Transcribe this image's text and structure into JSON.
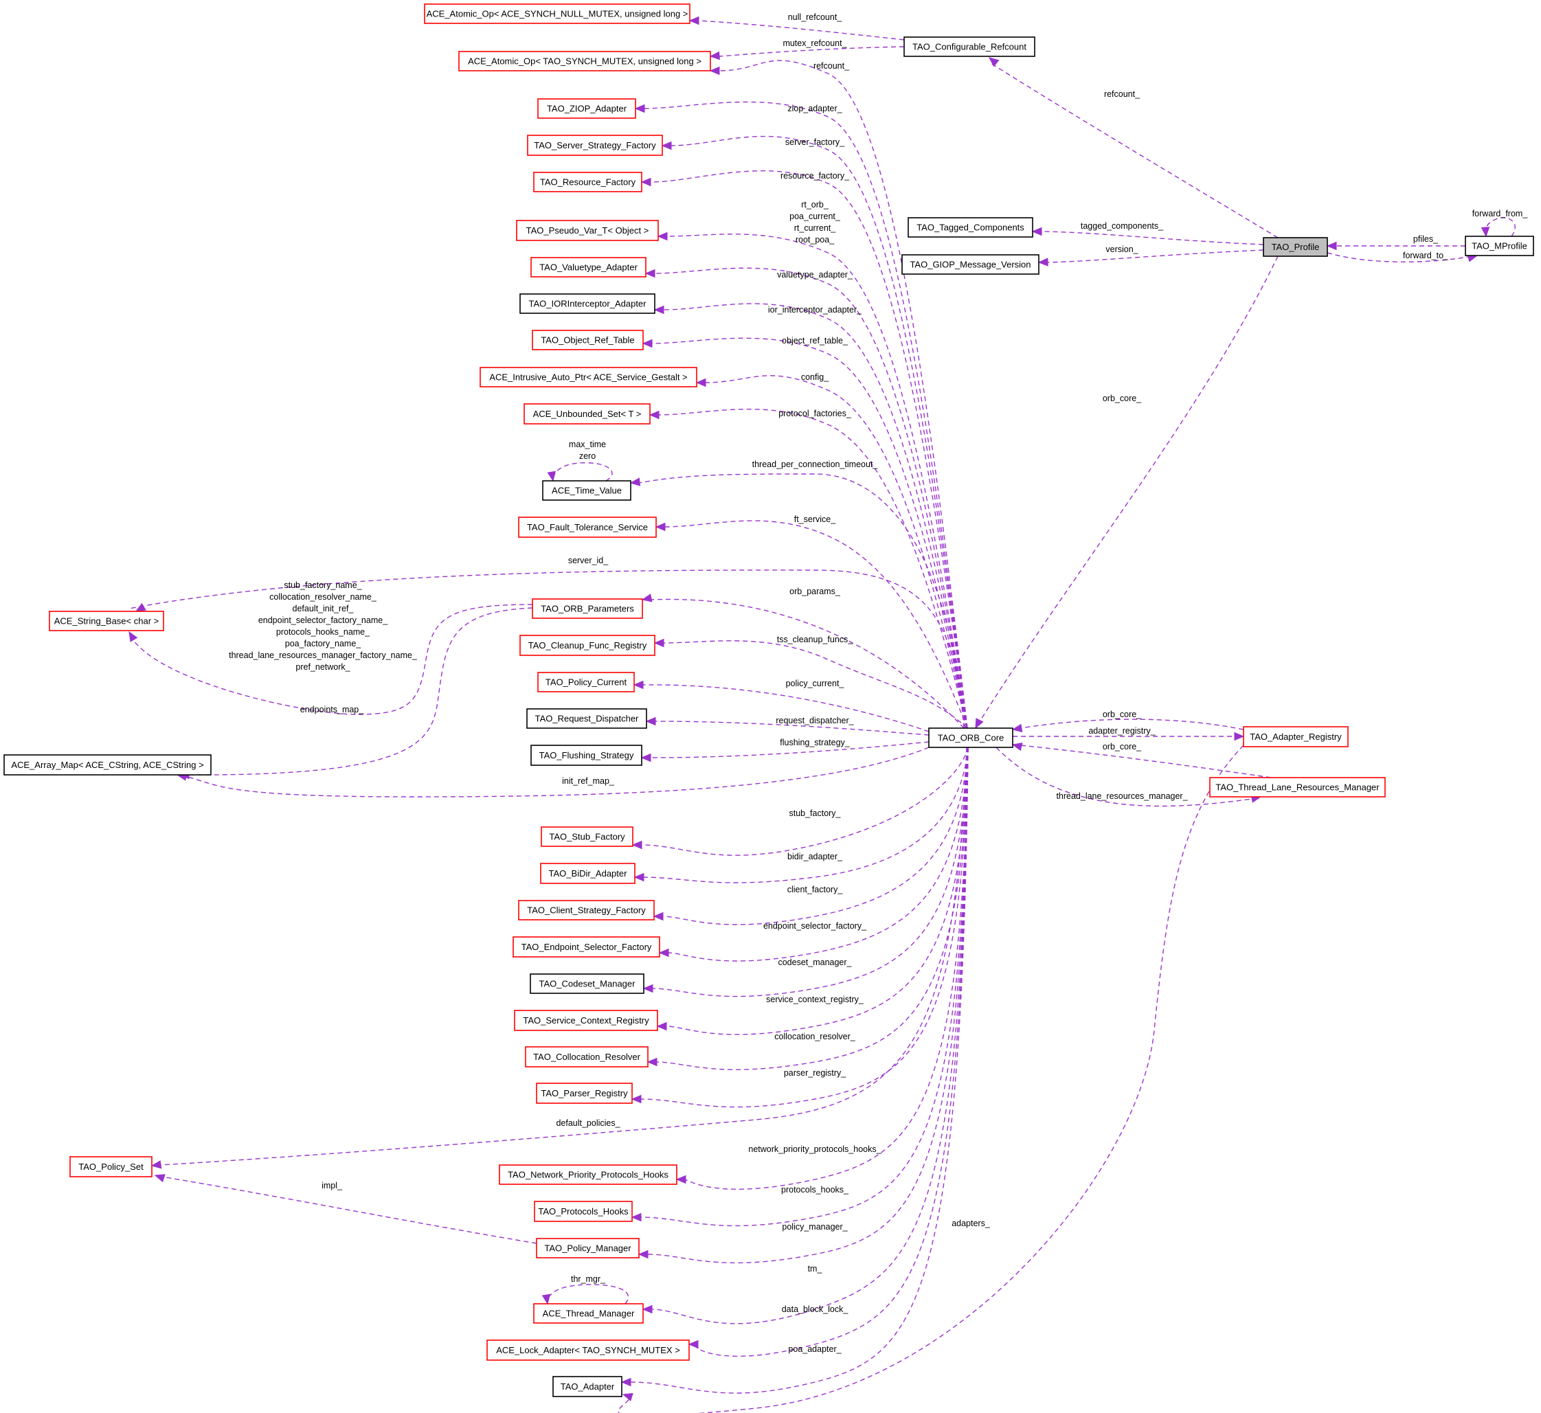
{
  "diagram": {
    "title": "TAO_Profile collaboration graph",
    "legend_colors": {
      "edge": "#9a32cd",
      "node_incomplete_border": "#ff0000",
      "node_complete_border": "#000000",
      "focus_fill": "#bfbfbf"
    },
    "nodes": {
      "atomic_null": "ACE_Atomic_Op< ACE_SYNCH_NULL_MUTEX, unsigned long >",
      "atomic_mutex": "ACE_Atomic_Op< TAO_SYNCH_MUTEX, unsigned long >",
      "configurable_refcount": "TAO_Configurable_Refcount",
      "ziop_adapter": "TAO_ZIOP_Adapter",
      "server_strategy_factory": "TAO_Server_Strategy_Factory",
      "resource_factory": "TAO_Resource_Factory",
      "pseudo_var": "TAO_Pseudo_Var_T< Object >",
      "tagged_components": "TAO_Tagged_Components",
      "giop_message_version": "TAO_GIOP_Message_Version",
      "profile": "TAO_Profile",
      "mprofile": "TAO_MProfile",
      "valuetype_adapter": "TAO_Valuetype_Adapter",
      "iorinterceptor_adapter": "TAO_IORInterceptor_Adapter",
      "object_ref_table": "TAO_Object_Ref_Table",
      "intrusive_auto_ptr": "ACE_Intrusive_Auto_Ptr< ACE_Service_Gestalt >",
      "unbounded_set": "ACE_Unbounded_Set< T >",
      "time_value": "ACE_Time_Value",
      "fault_tolerance_service": "TAO_Fault_Tolerance_Service",
      "string_base": "ACE_String_Base< char >",
      "orb_parameters": "TAO_ORB_Parameters",
      "cleanup_func_registry": "TAO_Cleanup_Func_Registry",
      "policy_current": "TAO_Policy_Current",
      "request_dispatcher": "TAO_Request_Dispatcher",
      "flushing_strategy": "TAO_Flushing_Strategy",
      "array_map": "ACE_Array_Map< ACE_CString, ACE_CString >",
      "orb_core": "TAO_ORB_Core",
      "adapter_registry": "TAO_Adapter_Registry",
      "thread_lane_resources_manager": "TAO_Thread_Lane_Resources_Manager",
      "stub_factory": "TAO_Stub_Factory",
      "bidir_adapter": "TAO_BiDir_Adapter",
      "client_strategy_factory": "TAO_Client_Strategy_Factory",
      "endpoint_selector_factory": "TAO_Endpoint_Selector_Factory",
      "codeset_manager": "TAO_Codeset_Manager",
      "service_context_registry": "TAO_Service_Context_Registry",
      "collocation_resolver": "TAO_Collocation_Resolver",
      "parser_registry": "TAO_Parser_Registry",
      "policy_set": "TAO_Policy_Set",
      "network_priority_protocols_hooks": "TAO_Network_Priority_Protocols_Hooks",
      "protocols_hooks": "TAO_Protocols_Hooks",
      "policy_manager": "TAO_Policy_Manager",
      "thread_manager": "ACE_Thread_Manager",
      "lock_adapter": "ACE_Lock_Adapter< TAO_SYNCH_MUTEX >",
      "adapter": "TAO_Adapter"
    },
    "edge_labels": {
      "null_refcount": "null_refcount_",
      "mutex_refcount": "mutex_refcount_",
      "refcount_orb": "refcount_",
      "refcount_profile": "refcount_",
      "ziop_adapter": "ziop_adapter_",
      "server_factory": "server_factory_",
      "resource_factory": "resource_factory_",
      "pseudo_var": [
        "rt_orb_",
        "poa_current_",
        "rt_current_",
        "root_poa_"
      ],
      "tagged_components": "tagged_components_",
      "version": "version_",
      "pfiles": "pfiles_",
      "forward_to": "forward_to_",
      "forward_from": "forward_from_",
      "valuetype_adapter": "valuetype_adapter_",
      "ior_interceptor_adapter": "ior_interceptor_adapter_",
      "object_ref_table": "object_ref_table_",
      "config": "config_",
      "protocol_factories": "protocol_factories_",
      "orb_core_profile": "orb_core_",
      "time_value_self": [
        "max_time",
        "zero"
      ],
      "thread_per_connection_timeout": "thread_per_connection_timeout_",
      "ft_service": "ft_service_",
      "server_id": "server_id_",
      "string_base_params": [
        "stub_factory_name_",
        "collocation_resolver_name_",
        "default_init_ref_",
        "endpoint_selector_factory_name_",
        "protocols_hooks_name_",
        "poa_factory_name_",
        "thread_lane_resources_manager_factory_name_",
        "pref_network_"
      ],
      "endpoints_map": "endpoints_map_",
      "orb_params": "orb_params_",
      "tss_cleanup_funcs": "tss_cleanup_funcs_",
      "policy_current": "policy_current_",
      "request_dispatcher": "request_dispatcher_",
      "flushing_strategy": "flushing_strategy_",
      "init_ref_map": "init_ref_map_",
      "orb_core_adapter_registry": "orb_core_",
      "adapter_registry": "adapter_registry_",
      "orb_core_tlrm": "orb_core_",
      "thread_lane_resources_manager": "thread_lane_resources_manager_",
      "stub_factory": "stub_factory_",
      "bidir_adapter": "bidir_adapter_",
      "client_factory": "client_factory_",
      "endpoint_selector_factory": "endpoint_selector_factory_",
      "codeset_manager": "codeset_manager_",
      "service_context_registry": "service_context_registry_",
      "collocation_resolver": "collocation_resolver_",
      "parser_registry": "parser_registry_",
      "default_policies": "default_policies_",
      "network_priority_protocols_hooks": "network_priority_protocols_hooks_",
      "protocols_hooks": "protocols_hooks_",
      "impl": "impl_",
      "policy_manager": "policy_manager_",
      "thr_mgr": "thr_mgr_",
      "tm": "tm_",
      "data_block_lock": "data_block_lock_",
      "poa_adapter": "poa_adapter_",
      "adapters": "adapters_"
    }
  }
}
